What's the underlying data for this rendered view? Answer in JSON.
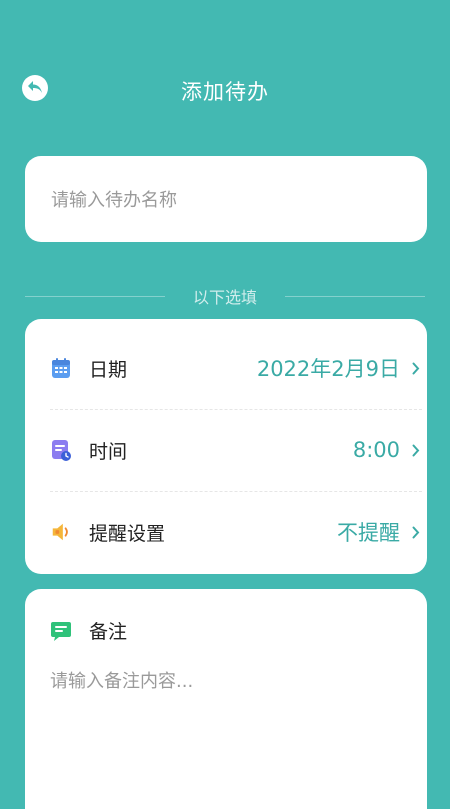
{
  "header": {
    "title": "添加待办",
    "back_icon": "back-arrow-icon"
  },
  "name_field": {
    "placeholder": "请输入待办名称",
    "value": ""
  },
  "divider": {
    "text": "以下选填"
  },
  "options": {
    "date": {
      "label": "日期",
      "value": "2022年2月9日",
      "icon": "calendar-icon"
    },
    "time": {
      "label": "时间",
      "value": "8:00",
      "icon": "clock-note-icon"
    },
    "reminder": {
      "label": "提醒设置",
      "value": "不提醒",
      "icon": "speaker-icon"
    }
  },
  "note": {
    "label": "备注",
    "icon": "chat-note-icon",
    "placeholder": "请输入备注内容...",
    "value": ""
  },
  "colors": {
    "background": "#43b9b2",
    "accent": "#3aaaa5"
  }
}
